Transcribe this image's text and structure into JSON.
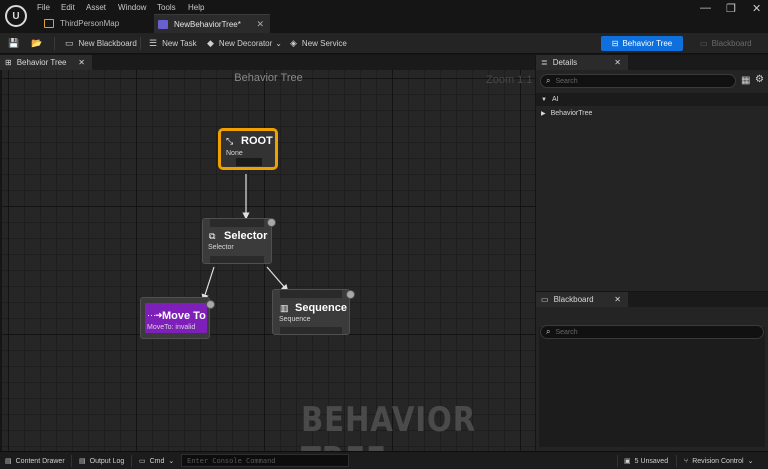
{
  "menu": [
    "File",
    "Edit",
    "Asset",
    "Window",
    "Tools",
    "Help"
  ],
  "tabs": [
    {
      "label": "ThirdPersonMap"
    },
    {
      "label": "NewBehaviorTree*"
    }
  ],
  "toolbar": {
    "new_blackboard": "New Blackboard",
    "new_task": "New Task",
    "new_decorator": "New Decorator",
    "new_service": "New Service",
    "mode_behavior_tree": "Behavior Tree",
    "mode_blackboard": "Blackboard"
  },
  "graph": {
    "tab_label": "Behavior Tree",
    "title": "Behavior Tree",
    "zoom": "Zoom 1:1",
    "watermark": "BEHAVIOR TREE",
    "nodes": {
      "root": {
        "title": "ROOT",
        "subtitle": "None",
        "color": "#f0a000"
      },
      "selector": {
        "title": "Selector",
        "subtitle": "Selector"
      },
      "moveto": {
        "title": "Move To",
        "subtitle": "MoveTo: invalid",
        "color": "#7e1fb9"
      },
      "sequence": {
        "title": "Sequence",
        "subtitle": "Sequence"
      }
    }
  },
  "details": {
    "tab_label": "Details",
    "search_placeholder": "Search",
    "categories": [
      "AI",
      "BehaviorTree"
    ]
  },
  "blackboard": {
    "tab_label": "Blackboard",
    "search_placeholder": "Search"
  },
  "statusbar": {
    "content_drawer": "Content Drawer",
    "output_log": "Output Log",
    "cmd": "Cmd",
    "console_placeholder": "Enter Console Command",
    "unsaved": "5 Unsaved",
    "revision_control": "Revision Control"
  },
  "colors": {
    "accent": "#0f6fdc",
    "root_outline": "#f0a000",
    "task_node": "#7e1fb9"
  }
}
